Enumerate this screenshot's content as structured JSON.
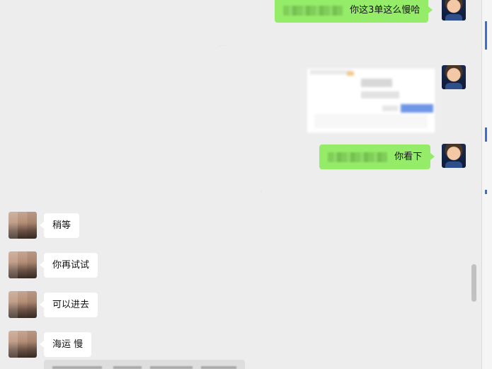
{
  "conversation": {
    "messages": [
      {
        "sender": "me",
        "type": "text",
        "text": "你这3单这么慢哈"
      },
      {
        "sender": "me",
        "type": "image"
      },
      {
        "sender": "me",
        "type": "text",
        "text": "你看下"
      },
      {
        "sender": "them",
        "type": "text",
        "text": "稍等"
      },
      {
        "sender": "them",
        "type": "text",
        "text": "你再试试"
      },
      {
        "sender": "them",
        "type": "text",
        "text": "可以进去"
      },
      {
        "sender": "them",
        "type": "text",
        "text": "海运 慢"
      }
    ]
  },
  "colors": {
    "background": "#ededed",
    "my_bubble": "#95ec69",
    "their_bubble": "#ffffff"
  }
}
